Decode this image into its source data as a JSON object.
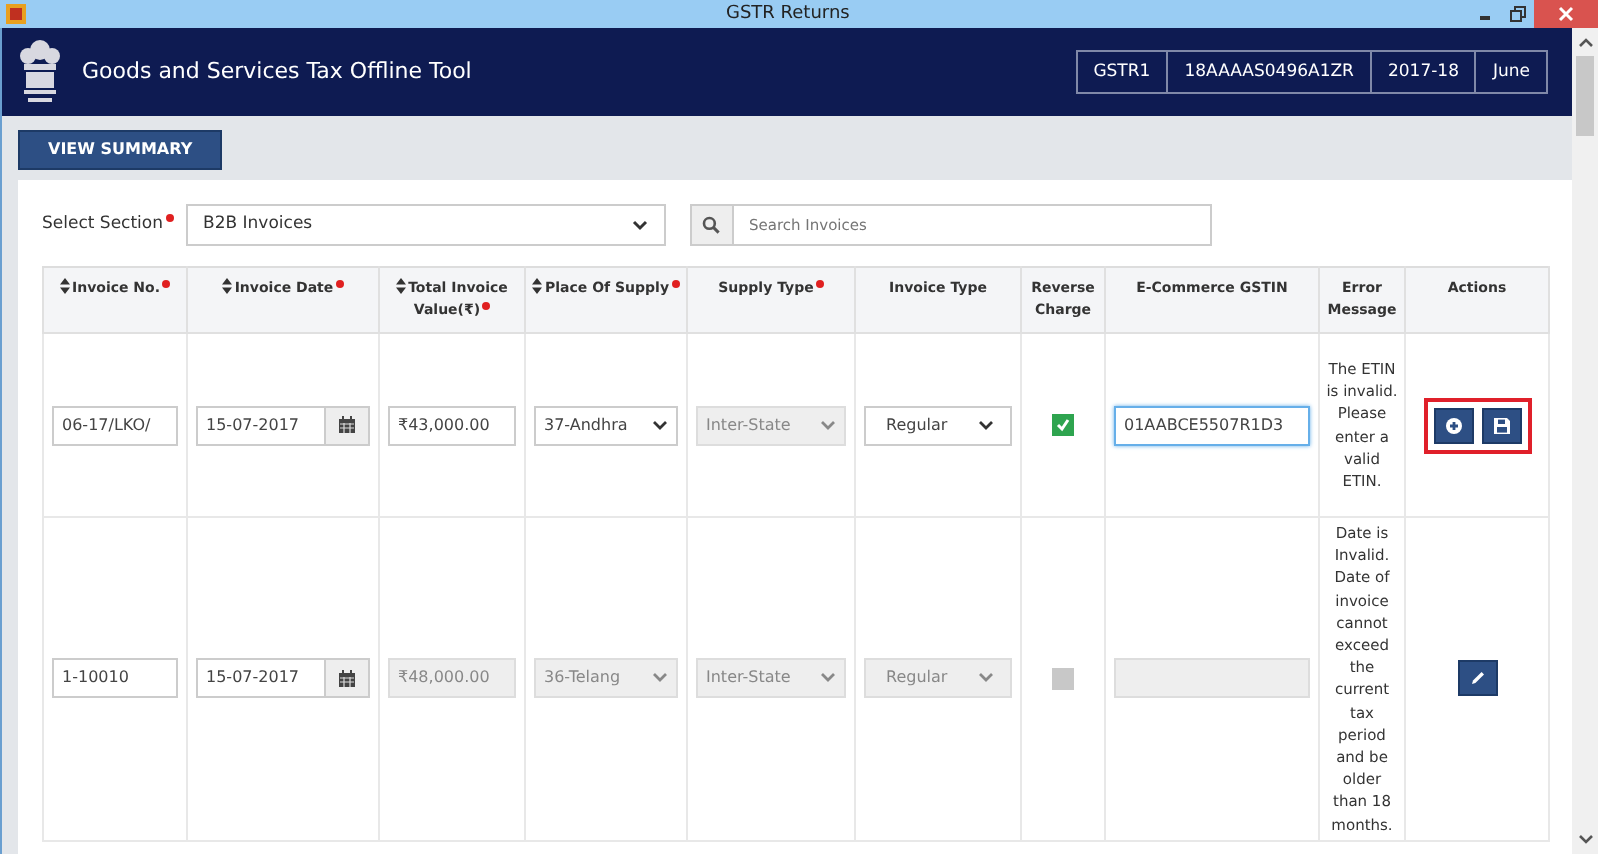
{
  "window": {
    "title": "GSTR Returns"
  },
  "header": {
    "title": "Goods and Services Tax Offline Tool",
    "badges": [
      "GSTR1",
      "18AAAAS0496A1ZR",
      "2017-18",
      "June"
    ]
  },
  "view_summary_button": "VIEW SUMMARY",
  "section": {
    "label": "Select Section",
    "required": true,
    "value": "B2B Invoices"
  },
  "search": {
    "placeholder": "Search Invoices"
  },
  "table": {
    "columns": [
      {
        "label": "Invoice No.",
        "sortable": true,
        "required": true
      },
      {
        "label": "Invoice Date",
        "sortable": true,
        "required": true
      },
      {
        "label": "Total Invoice Value(₹)",
        "sortable": true,
        "required": true
      },
      {
        "label": "Place Of Supply",
        "sortable": true,
        "required": true
      },
      {
        "label": "Supply Type",
        "sortable": false,
        "required": true
      },
      {
        "label": "Invoice Type",
        "sortable": false,
        "required": false
      },
      {
        "label": "Reverse Charge",
        "sortable": false,
        "required": false
      },
      {
        "label": "E-Commerce GSTIN",
        "sortable": false,
        "required": false
      },
      {
        "label": "Error Message",
        "sortable": false,
        "required": false
      },
      {
        "label": "Actions",
        "sortable": false,
        "required": false
      }
    ],
    "rows": [
      {
        "invoice_no": {
          "value": "06-17/LKO/",
          "disabled": false
        },
        "invoice_date": {
          "value": "15-07-2017",
          "disabled": false
        },
        "total_value": {
          "value": "₹43,000.00",
          "disabled": false
        },
        "place_of_supply": {
          "value": "37-Andhra",
          "disabled": false
        },
        "supply_type": {
          "value": "Inter-State",
          "disabled": true
        },
        "invoice_type": {
          "value": "Regular",
          "disabled": false
        },
        "reverse_charge": {
          "checked": true,
          "disabled": false
        },
        "ecommerce_gstin": {
          "value": "01AABCE5507R1D3",
          "disabled": false,
          "focused": true
        },
        "error_message": "The ETIN is invalid. Please enter a valid ETIN.",
        "actions_highlighted": true,
        "actions": [
          {
            "kind": "add"
          },
          {
            "kind": "save"
          }
        ]
      },
      {
        "invoice_no": {
          "value": "1-10010",
          "disabled": false
        },
        "invoice_date": {
          "value": "15-07-2017",
          "disabled": false
        },
        "total_value": {
          "value": "₹48,000.00",
          "disabled": true
        },
        "place_of_supply": {
          "value": "36-Telang",
          "disabled": true
        },
        "supply_type": {
          "value": "Inter-State",
          "disabled": true
        },
        "invoice_type": {
          "value": "Regular",
          "disabled": true
        },
        "reverse_charge": {
          "checked": false,
          "disabled": true
        },
        "ecommerce_gstin": {
          "disabled": true,
          "focused": false
        },
        "error_message": "Date is Invalid. Date of invoice cannot exceed the current tax period and be older than 18 months.",
        "actions_highlighted": false,
        "actions": [
          {
            "kind": "edit"
          }
        ]
      }
    ]
  }
}
